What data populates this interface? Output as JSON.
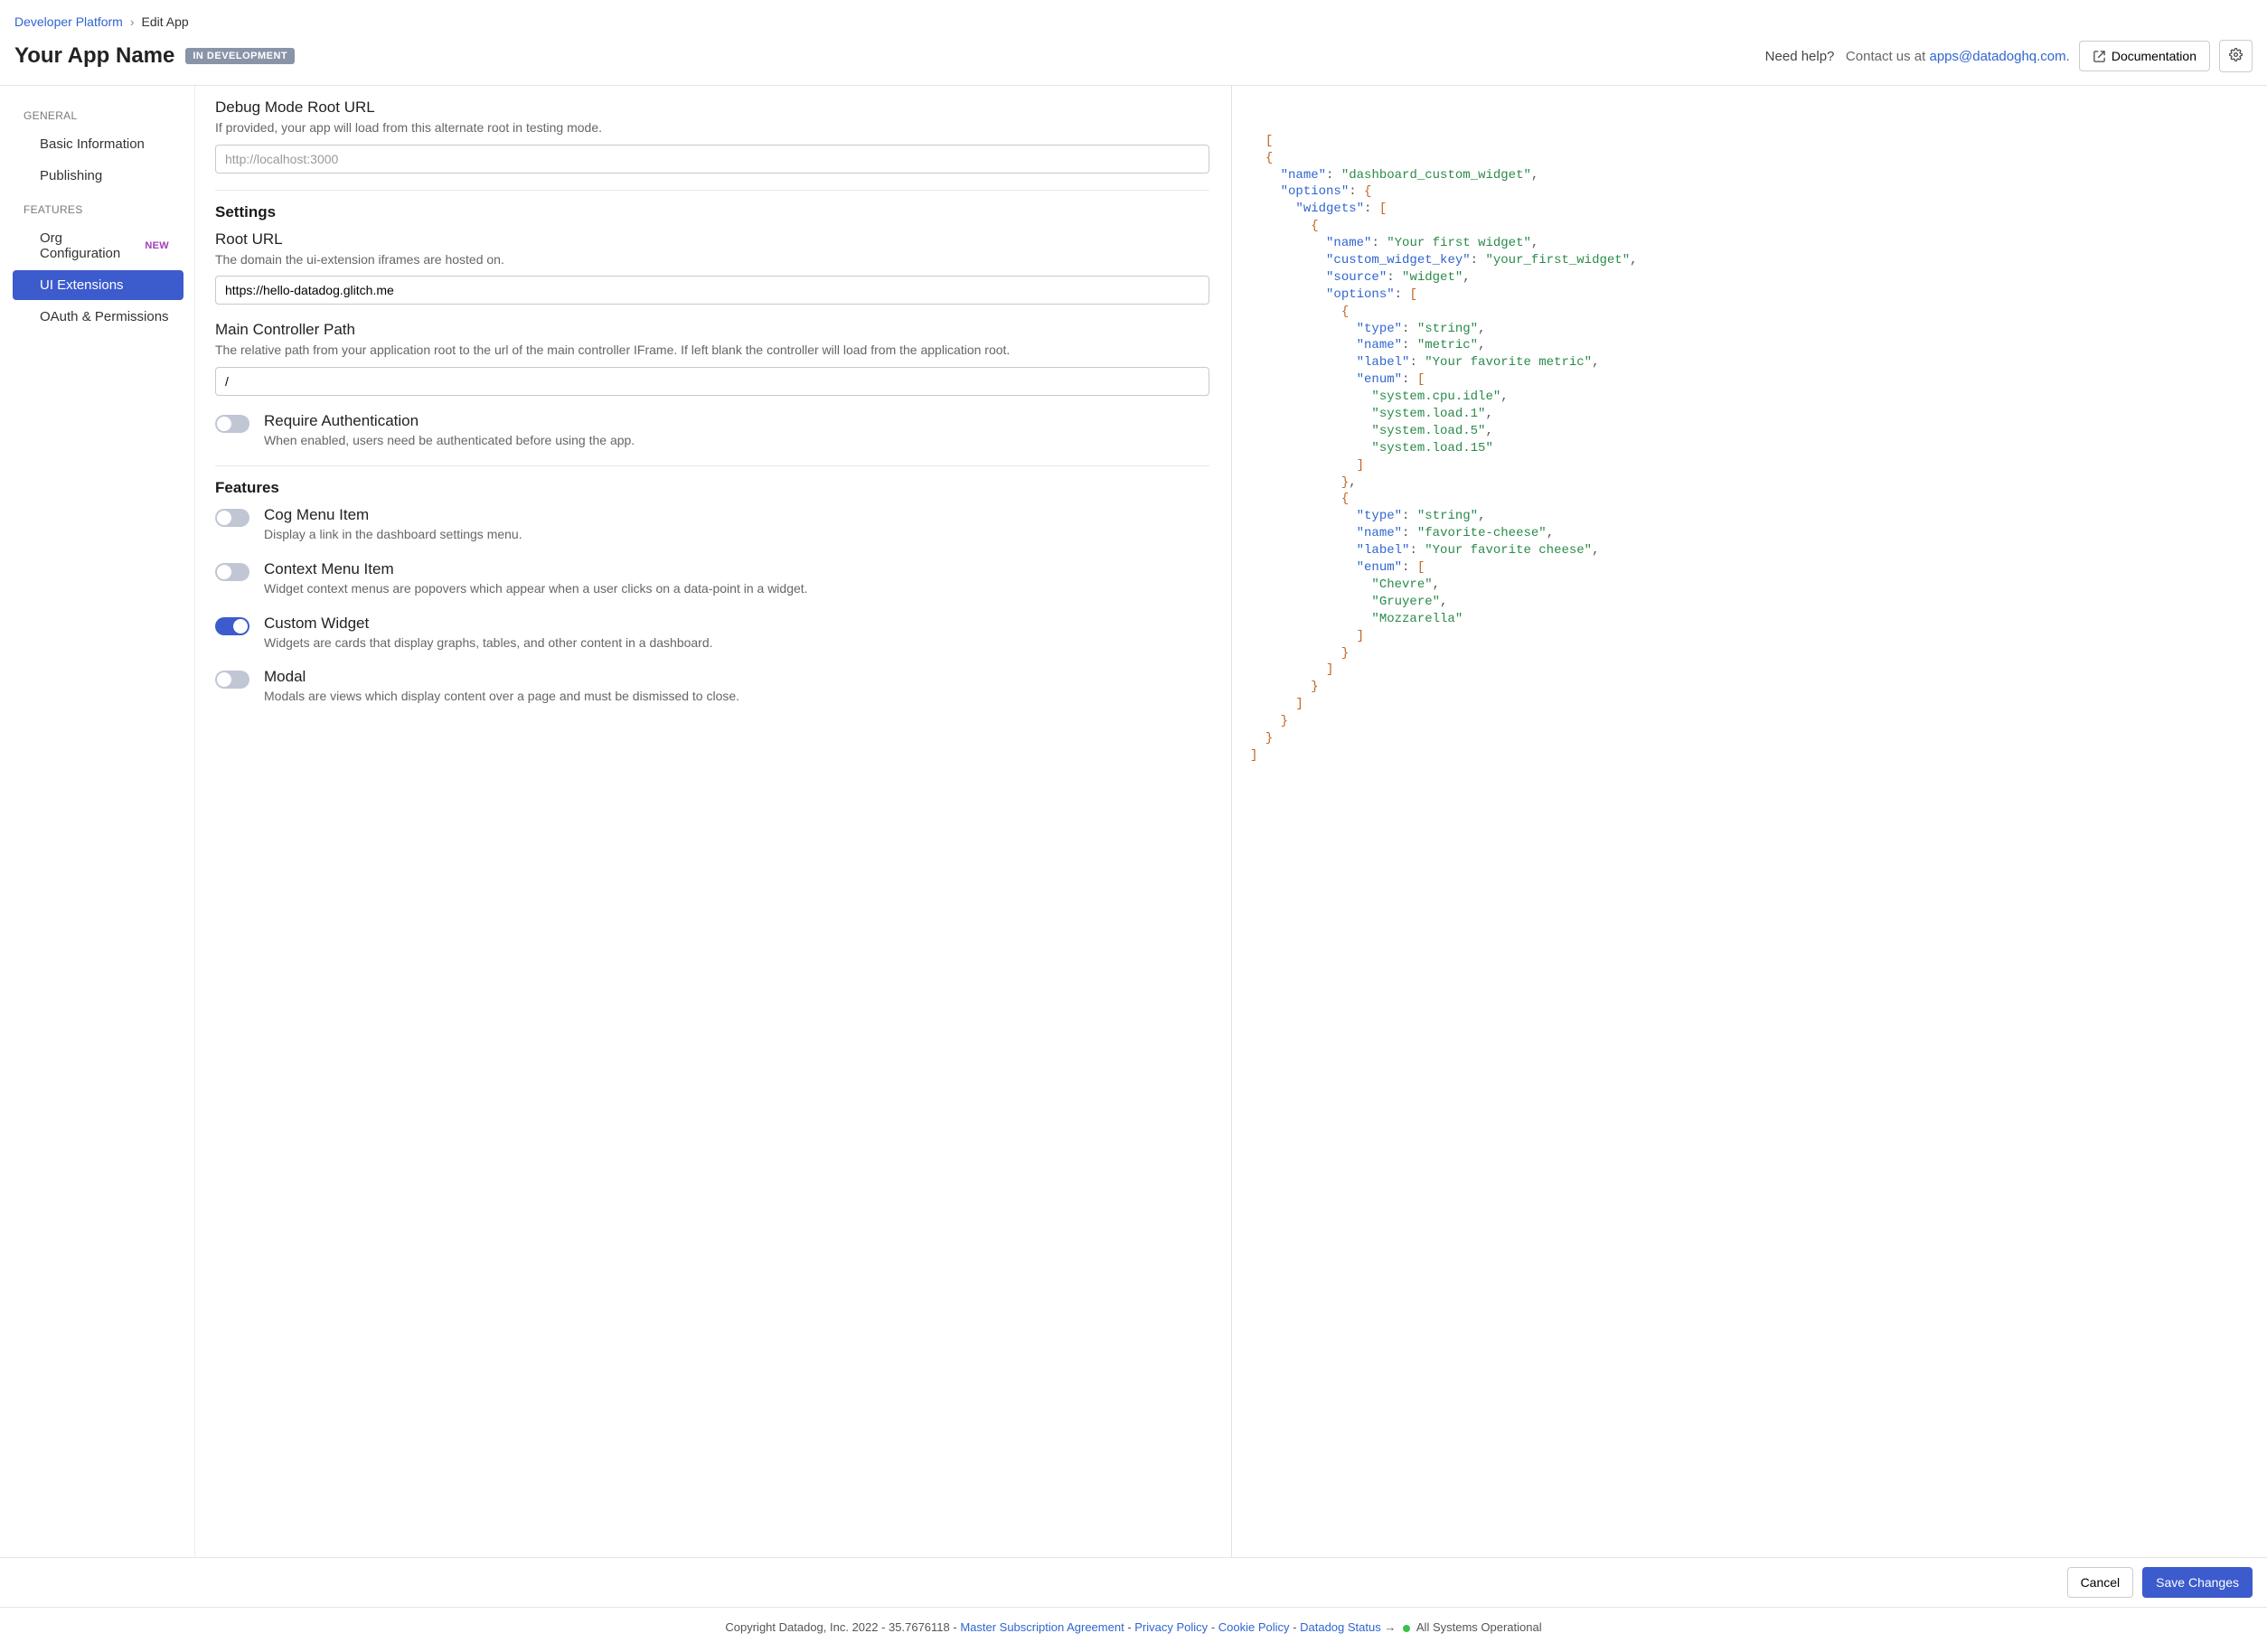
{
  "breadcrumb": {
    "platform": "Developer Platform",
    "current": "Edit App"
  },
  "header": {
    "app_name": "Your App Name",
    "dev_badge": "IN DEVELOPMENT",
    "need_help": "Need help?",
    "contact_prefix": "Contact us at ",
    "contact_email": "apps@datadoghq.com",
    "contact_suffix": ".",
    "documentation": "Documentation"
  },
  "sidebar": {
    "general_label": "GENERAL",
    "features_label": "FEATURES",
    "items": {
      "basic_info": "Basic Information",
      "publishing": "Publishing",
      "org_config": "Org Configuration",
      "ui_extensions": "UI Extensions",
      "oauth": "OAuth & Permissions",
      "new_badge": "NEW"
    }
  },
  "form": {
    "debug": {
      "label": "Debug Mode Root URL",
      "desc": "If provided, your app will load from this alternate root in testing mode.",
      "placeholder": "http://localhost:3000",
      "value": ""
    },
    "settings_title": "Settings",
    "root_url": {
      "label": "Root URL",
      "desc": "The domain the ui-extension iframes are hosted on.",
      "value": "https://hello-datadog.glitch.me"
    },
    "controller": {
      "label": "Main Controller Path",
      "desc": "The relative path from your application root to the url of the main controller IFrame. If left blank the controller will load from the application root.",
      "value": "/"
    },
    "require_auth": {
      "title": "Require Authentication",
      "desc": "When enabled, users need be authenticated before using the app.",
      "on": false
    },
    "features_title": "Features",
    "cog_menu": {
      "title": "Cog Menu Item",
      "desc": "Display a link in the dashboard settings menu.",
      "on": false
    },
    "context_menu": {
      "title": "Context Menu Item",
      "desc": "Widget context menus are popovers which appear when a user clicks on a data-point in a widget.",
      "on": false
    },
    "custom_widget": {
      "title": "Custom Widget",
      "desc": "Widgets are cards that display graphs, tables, and other content in a dashboard.",
      "on": true
    },
    "modal": {
      "title": "Modal",
      "desc": "Modals are views which display content over a page and must be dismissed to close.",
      "on": false
    }
  },
  "actions": {
    "cancel": "Cancel",
    "save": "Save Changes"
  },
  "footer": {
    "copyright": "Copyright Datadog, Inc. 2022 - 35.7676118 - ",
    "msa": "Master Subscription Agreement",
    "privacy": "Privacy Policy",
    "cookie": "Cookie Policy",
    "status": "Datadog Status",
    "arrow": "→",
    "ops": "All Systems Operational",
    "sep": " - "
  },
  "json_preview": [
    {
      "name": "dashboard_custom_widget",
      "options": {
        "widgets": [
          {
            "name": "Your first widget",
            "custom_widget_key": "your_first_widget",
            "source": "widget",
            "options": [
              {
                "type": "string",
                "name": "metric",
                "label": "Your favorite metric",
                "enum": [
                  "system.cpu.idle",
                  "system.load.1",
                  "system.load.5",
                  "system.load.15"
                ]
              },
              {
                "type": "string",
                "name": "favorite-cheese",
                "label": "Your favorite cheese",
                "enum": [
                  "Chevre",
                  "Gruyere",
                  "Mozzarella"
                ]
              }
            ]
          }
        ]
      }
    }
  ]
}
